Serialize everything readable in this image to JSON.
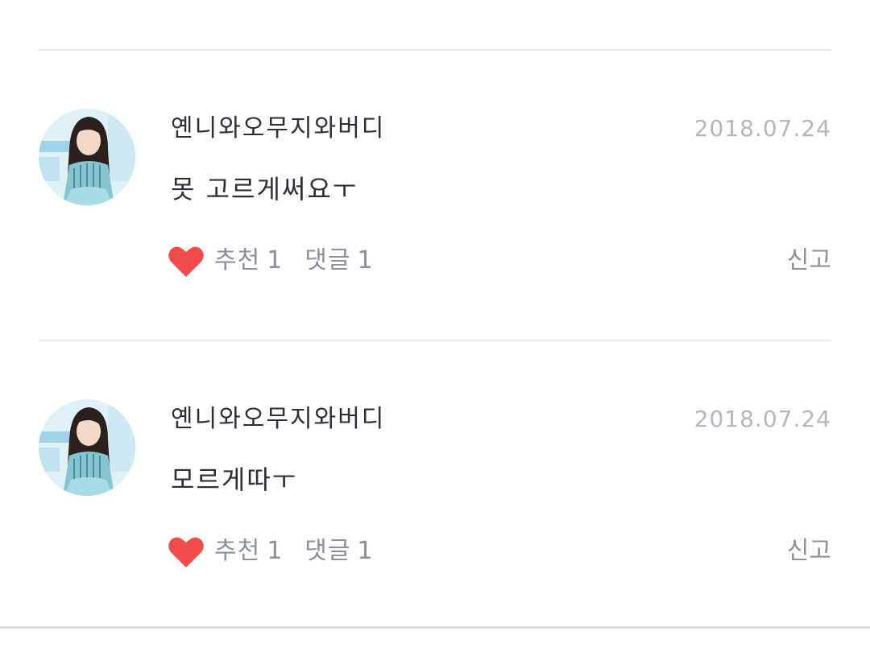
{
  "comments": [
    {
      "author": "옌니와오무지와버디",
      "date": "2018.07.24",
      "text": "못 고르게써요ㅜ",
      "like_label": "추천",
      "like_count": "1",
      "reply_label": "댓글",
      "reply_count": "1",
      "report_label": "신고"
    },
    {
      "author": "옌니와오무지와버디",
      "date": "2018.07.24",
      "text": "모르게따ㅜ",
      "like_label": "추천",
      "like_count": "1",
      "reply_label": "댓글",
      "reply_count": "1",
      "report_label": "신고"
    }
  ],
  "colors": {
    "heart": "#f24b4b",
    "divider": "#e7e9ec",
    "author_text": "#2c2f36",
    "meta_text": "#8b9099",
    "date_text": "#b3b8c0"
  },
  "icons": {
    "like": "heart-icon",
    "avatar": "profile-photo"
  }
}
